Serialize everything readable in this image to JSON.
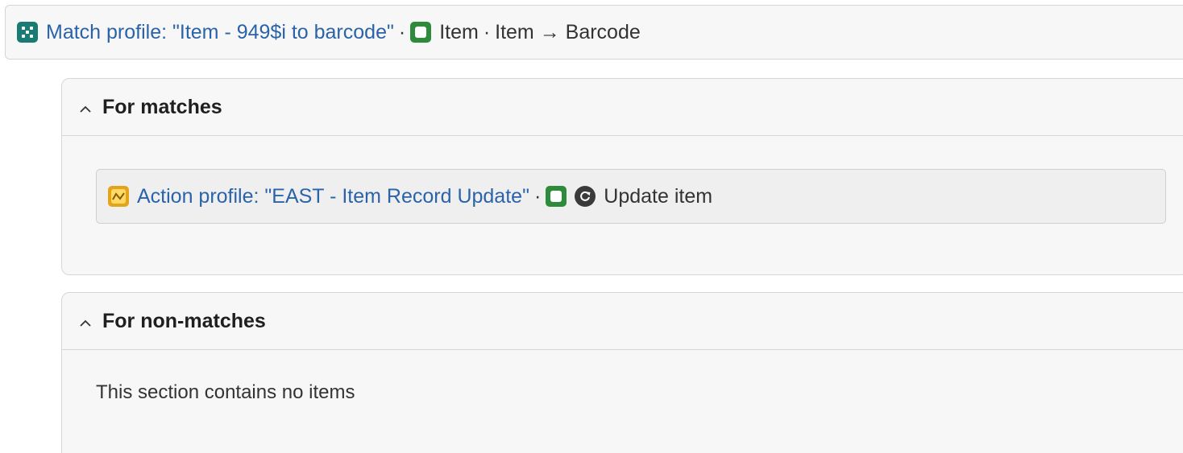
{
  "header": {
    "match_profile_link": "Match profile: \"Item - 949$i to barcode\"",
    "separator_1": "·",
    "record_type": "Item",
    "separator_2": "·",
    "mapping": "Item → Barcode",
    "icons": {
      "match_profile": "match-profile-icon",
      "record": "item-record-icon"
    },
    "colors": {
      "link": "#2b63a8",
      "match_icon": "#1a7a74",
      "item_icon": "#2e8b3c"
    }
  },
  "for_matches": {
    "title": "For matches",
    "action": {
      "link": "Action profile: \"EAST - Item Record Update\"",
      "separator": "·",
      "label": "Update item",
      "icons": {
        "action_profile": "action-profile-icon",
        "record": "item-record-icon",
        "action": "update-icon"
      },
      "colors": {
        "action_icon": "#e4a419"
      }
    }
  },
  "for_non_matches": {
    "title": "For non-matches",
    "empty_message": "This section contains no items"
  }
}
